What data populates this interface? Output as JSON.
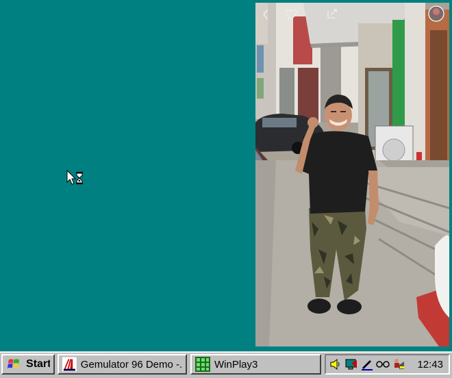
{
  "taskbar": {
    "start_label": "Start",
    "tasks": [
      {
        "label": "Gemulator 96 Demo -...",
        "icon": "gemulator-icon"
      },
      {
        "label": "WinPlay3",
        "icon": "winplay-icon"
      }
    ],
    "tray_icons": [
      "speaker-icon",
      "monitor-icon",
      "pen-icon",
      "glasses-icon",
      "scheduler-icon"
    ],
    "clock": "12:43"
  },
  "cursor": {
    "icon": "busy-arrow-hourglass-icon"
  },
  "photo": {
    "description_icon": "street-photo"
  },
  "colors": {
    "desktop": "#008080",
    "taskbar": "#c0c0c0"
  }
}
